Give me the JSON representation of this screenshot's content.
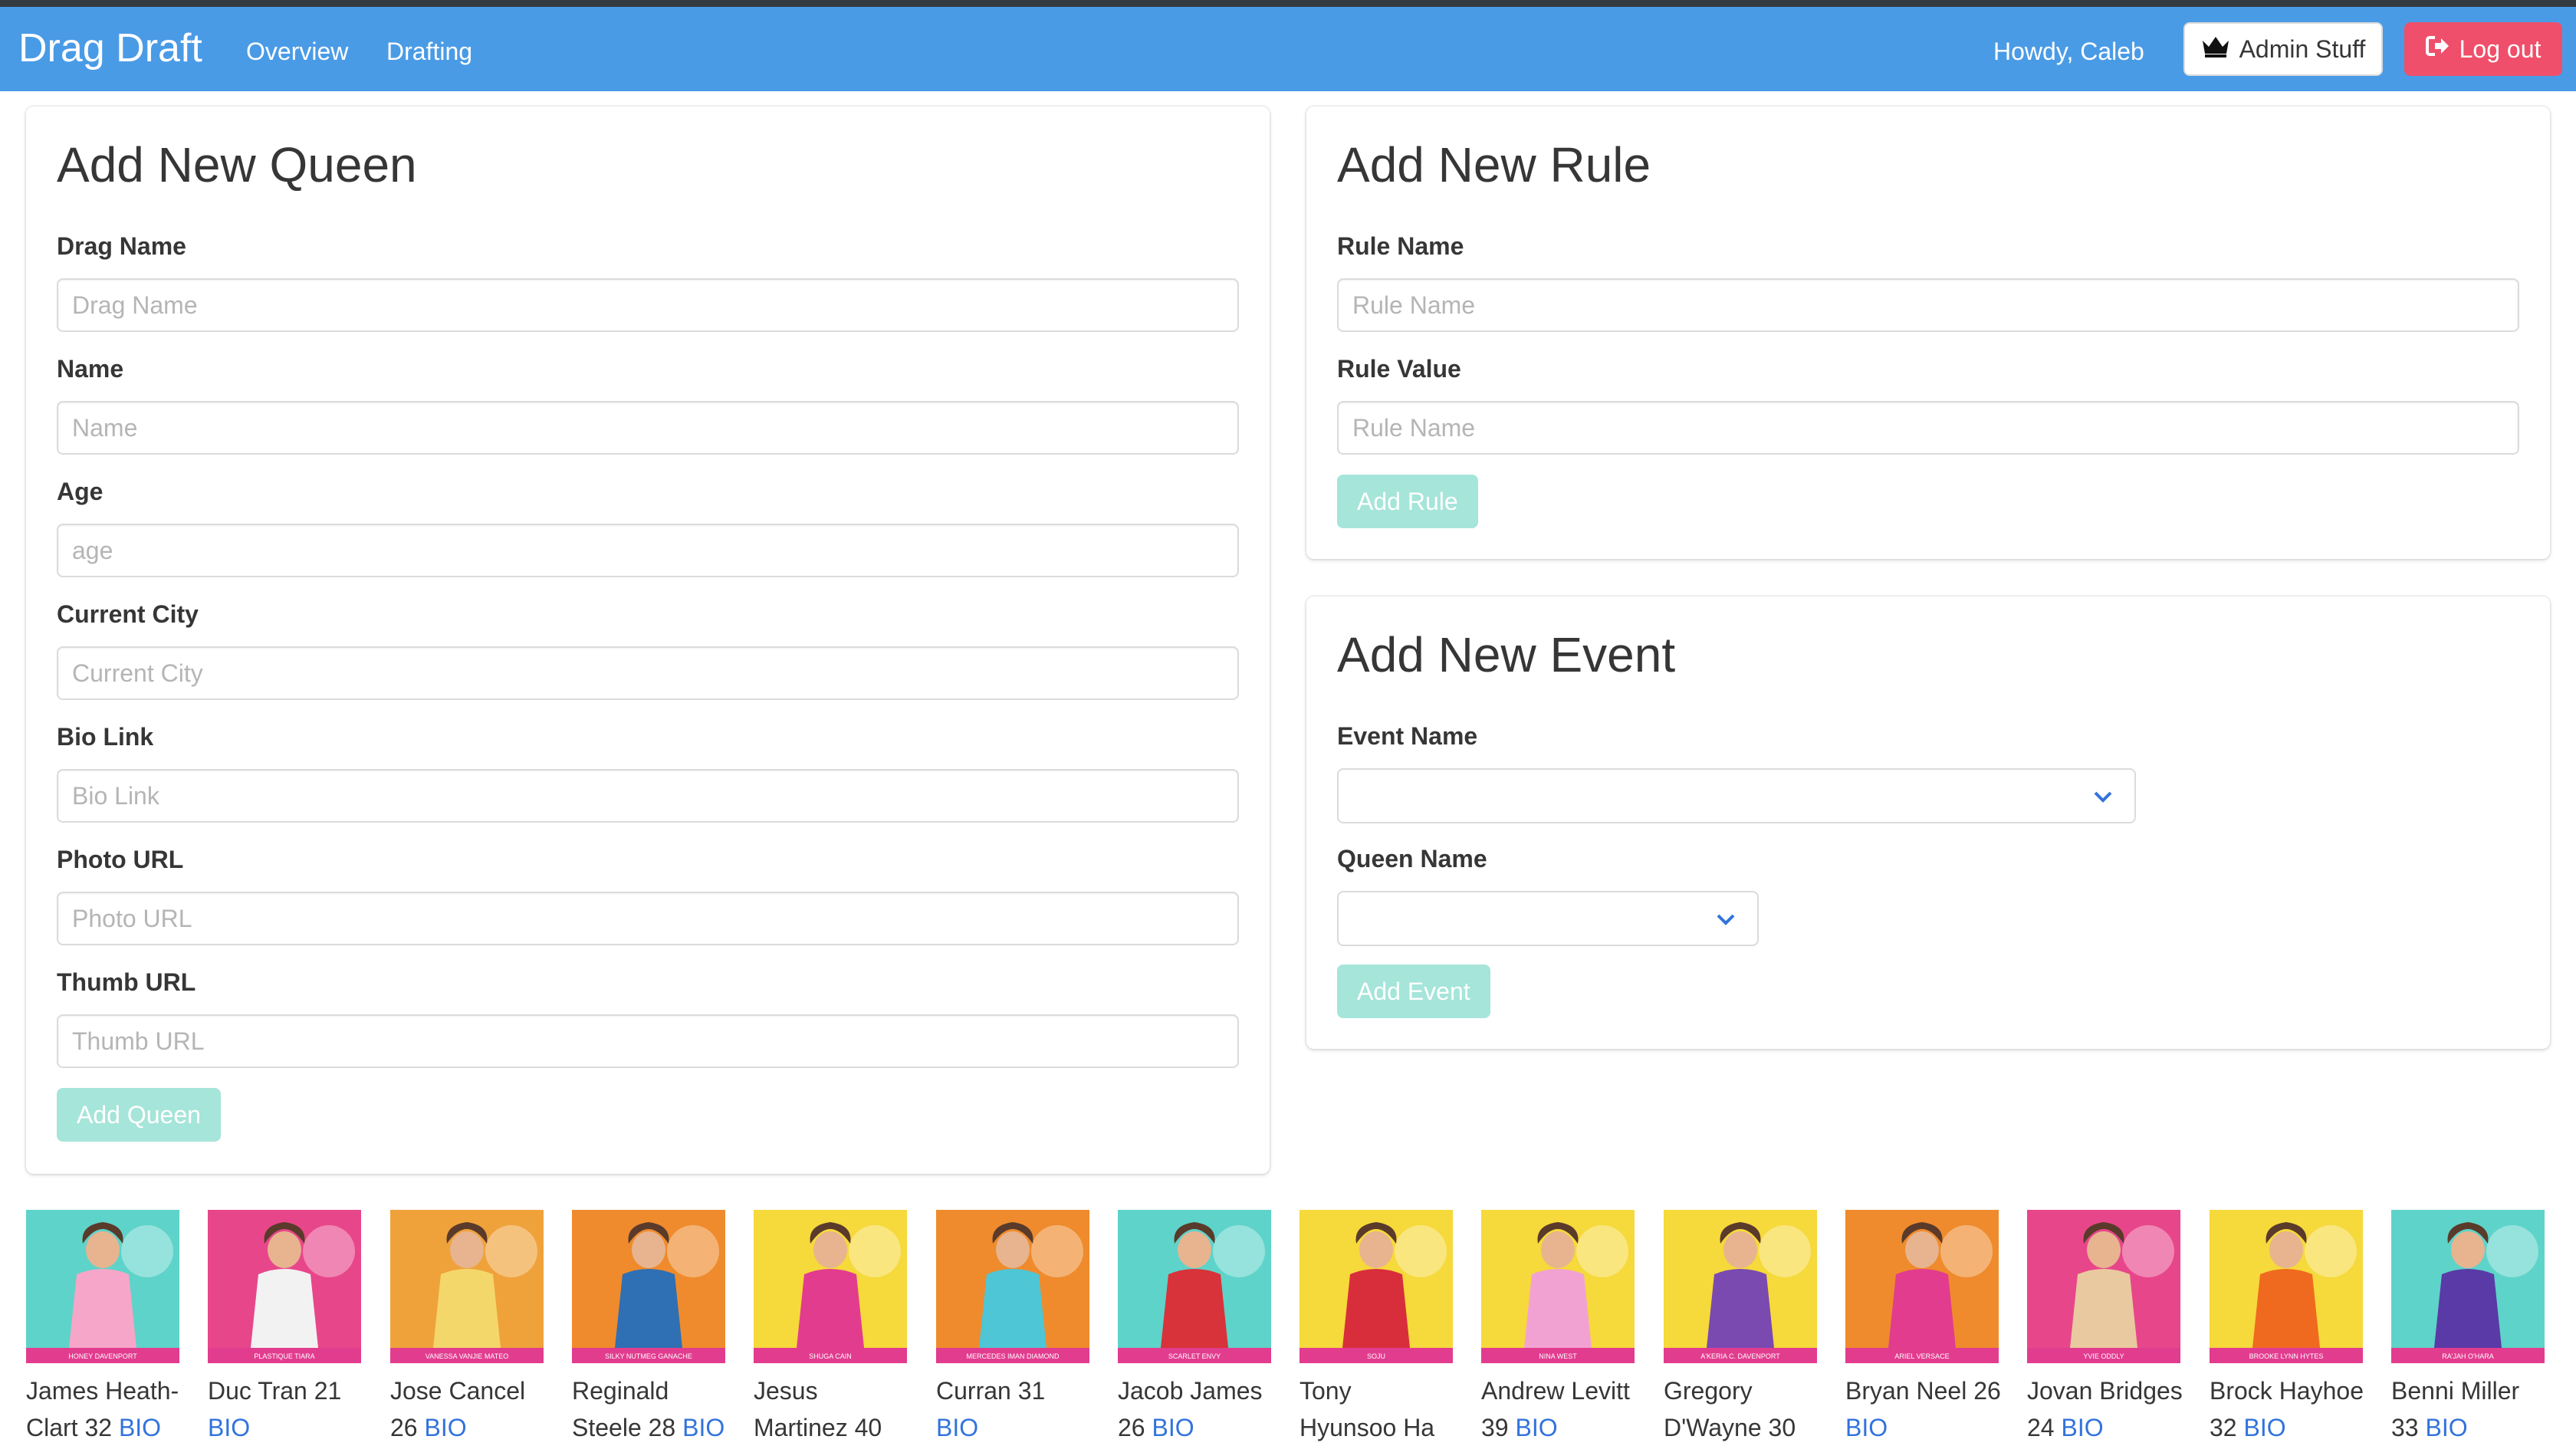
{
  "navbar": {
    "brand": "Drag Draft",
    "links": [
      "Overview",
      "Drafting"
    ],
    "greeting": "Howdy, Caleb",
    "admin_label": "Admin Stuff",
    "logout_label": "Log out",
    "color": "#4a9be6"
  },
  "add_queen": {
    "title": "Add New Queen",
    "fields": [
      {
        "label": "Drag Name",
        "placeholder": "Drag Name"
      },
      {
        "label": "Name",
        "placeholder": "Name"
      },
      {
        "label": "Age",
        "placeholder": "age"
      },
      {
        "label": "Current City",
        "placeholder": "Current City"
      },
      {
        "label": "Bio Link",
        "placeholder": "Bio Link"
      },
      {
        "label": "Photo URL",
        "placeholder": "Photo URL"
      },
      {
        "label": "Thumb URL",
        "placeholder": "Thumb URL"
      }
    ],
    "submit": "Add Queen"
  },
  "add_rule": {
    "title": "Add New Rule",
    "fields": [
      {
        "label": "Rule Name",
        "placeholder": "Rule Name"
      },
      {
        "label": "Rule Value",
        "placeholder": "Rule Name"
      }
    ],
    "submit": "Add Rule"
  },
  "add_event": {
    "title": "Add New Event",
    "event_label": "Event Name",
    "queen_label": "Queen Name",
    "submit": "Add Event"
  },
  "queens": [
    {
      "line1": "James Heath-",
      "line2": "Clart 32",
      "bio": "BIO",
      "banner": "HONEY DAVENPORT",
      "bg": "#5ed3c9",
      "outfit": "#f6a6c8"
    },
    {
      "line1": "Duc Tran 21",
      "line2": "",
      "bio": "BIO",
      "banner": "PLASTIQUE TIARA",
      "bg": "#e8468a",
      "outfit": "#f2f2f2"
    },
    {
      "line1": "Jose Cancel",
      "line2": "26",
      "bio": "BIO",
      "banner": "VANESSA VANJIE MATEO",
      "bg": "#f0a23a",
      "outfit": "#f4d76a"
    },
    {
      "line1": "Reginald",
      "line2": "Steele 28",
      "bio": "BIO",
      "banner": "SILKY NUTMEG GANACHE",
      "bg": "#ef8b2c",
      "outfit": "#2f6fb3"
    },
    {
      "line1": "Jesus",
      "line2": "Martinez 40",
      "bio": "",
      "banner": "SHUGA CAIN",
      "bg": "#f6d93a",
      "outfit": "#e23c8f"
    },
    {
      "line1": "Curran 31",
      "line2": "",
      "bio": "BIO",
      "banner": "MERCEDES IMAN DIAMOND",
      "bg": "#ef8b2c",
      "outfit": "#4ec6d6"
    },
    {
      "line1": "Jacob James",
      "line2": "26",
      "bio": "BIO",
      "banner": "SCARLET ENVY",
      "bg": "#5ed3c9",
      "outfit": "#d8323a"
    },
    {
      "line1": "Tony",
      "line2": "Hyunsoo Ha",
      "bio": "",
      "banner": "SOJU",
      "bg": "#f6d93a",
      "outfit": "#d82e3c"
    },
    {
      "line1": "Andrew Levitt",
      "line2": "39",
      "bio": "BIO",
      "banner": "NINA WEST",
      "bg": "#f6d93a",
      "outfit": "#f2a2d2"
    },
    {
      "line1": "Gregory",
      "line2": "D'Wayne 30",
      "bio": "",
      "banner": "A'KERIA C. DAVENPORT",
      "bg": "#f6d93a",
      "outfit": "#7a4ab0"
    },
    {
      "line1": "Bryan Neel 26",
      "line2": "",
      "bio": "BIO",
      "banner": "ARIEL VERSACE",
      "bg": "#ef8b2c",
      "outfit": "#e23c8f"
    },
    {
      "line1": "Jovan Bridges",
      "line2": "24",
      "bio": "BIO",
      "banner": "YVIE ODDLY",
      "bg": "#e8468a",
      "outfit": "#e9c9a0"
    },
    {
      "line1": "Brock Hayhoe",
      "line2": "32",
      "bio": "BIO",
      "banner": "BROOKE LYNN HYTES",
      "bg": "#f6d93a",
      "outfit": "#ef6a1f"
    },
    {
      "line1": "Benni Miller",
      "line2": "33",
      "bio": "BIO",
      "banner": "RA'JAH O'HARA",
      "bg": "#5ed3c9",
      "outfit": "#5a3aa6"
    }
  ]
}
